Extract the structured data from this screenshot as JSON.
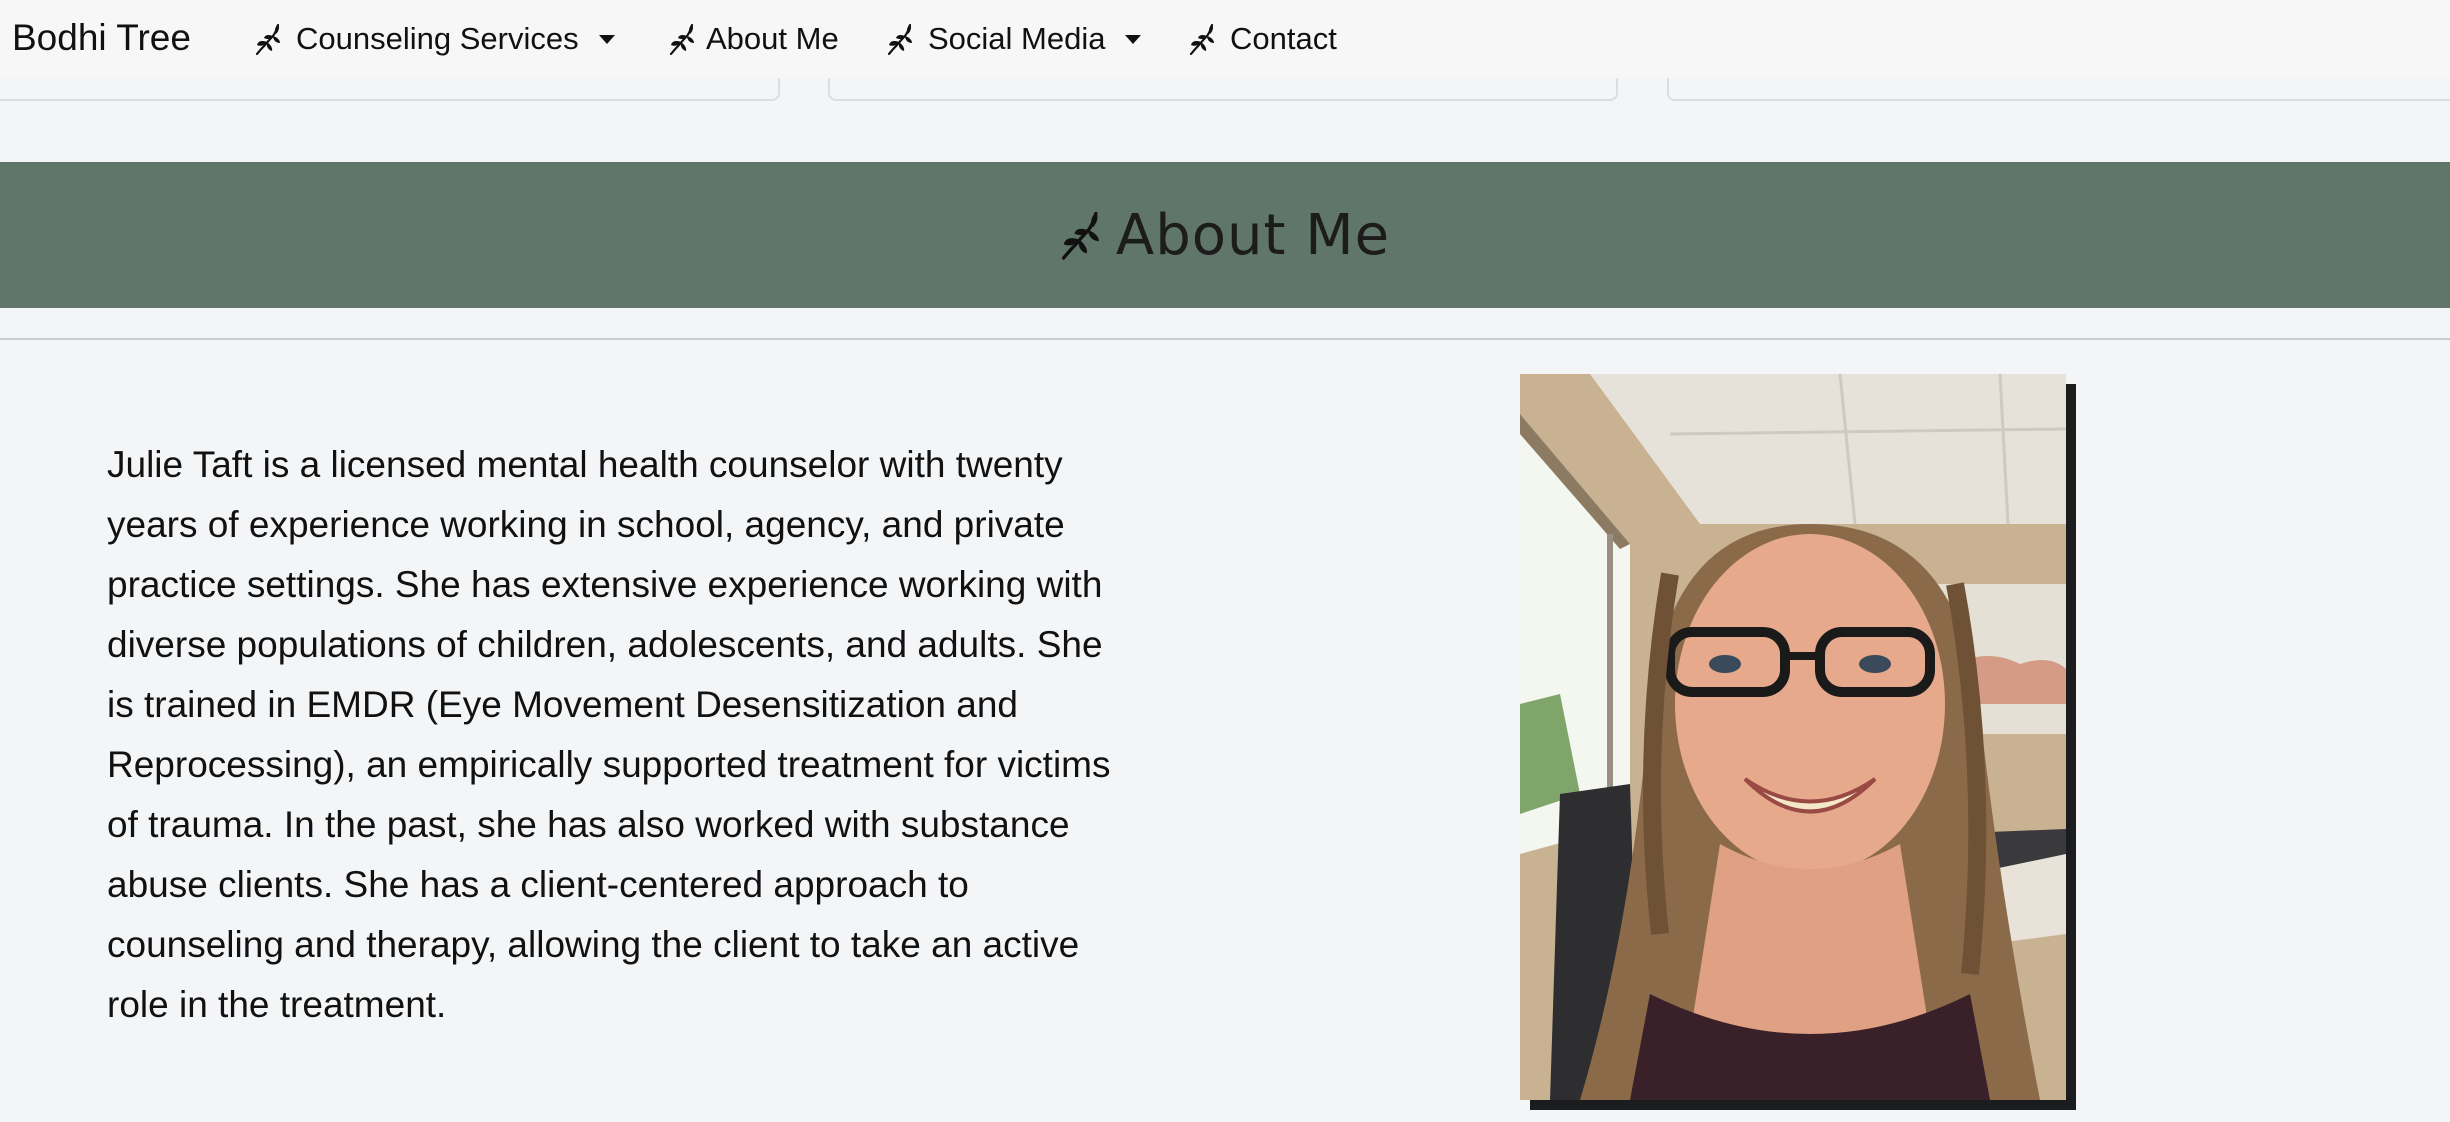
{
  "navbar": {
    "brand": "Bodhi Tree",
    "items": [
      {
        "label": "Counseling Services",
        "icon": "leaf-icon",
        "dropdown": true
      },
      {
        "label": "About Me",
        "icon": "leaf-icon",
        "dropdown": false
      },
      {
        "label": "Social Media",
        "icon": "leaf-icon",
        "dropdown": true
      },
      {
        "label": "Contact",
        "icon": "leaf-icon",
        "dropdown": false
      }
    ]
  },
  "banner": {
    "title": "About Me",
    "icon": "leaf-icon",
    "background": "#60766b"
  },
  "bio": {
    "text": "Julie Taft is a licensed mental health counselor with twenty years of experience working in school, agency, and private practice settings. She has extensive experience working with diverse populations of children, adolescents, and adults. She is trained in EMDR (Eye Movement Desensitization and Reprocessing), an empirically supported treatment for victims of trauma. In the past, she has also worked with substance abuse clients. She has a client-centered approach to counseling and therapy, allowing the client to take an active role in the treatment."
  },
  "photo": {
    "subject": "portrait-photo"
  },
  "colors": {
    "page_background": "#f4f5f7",
    "banner": "#60766b",
    "text": "#111111"
  }
}
